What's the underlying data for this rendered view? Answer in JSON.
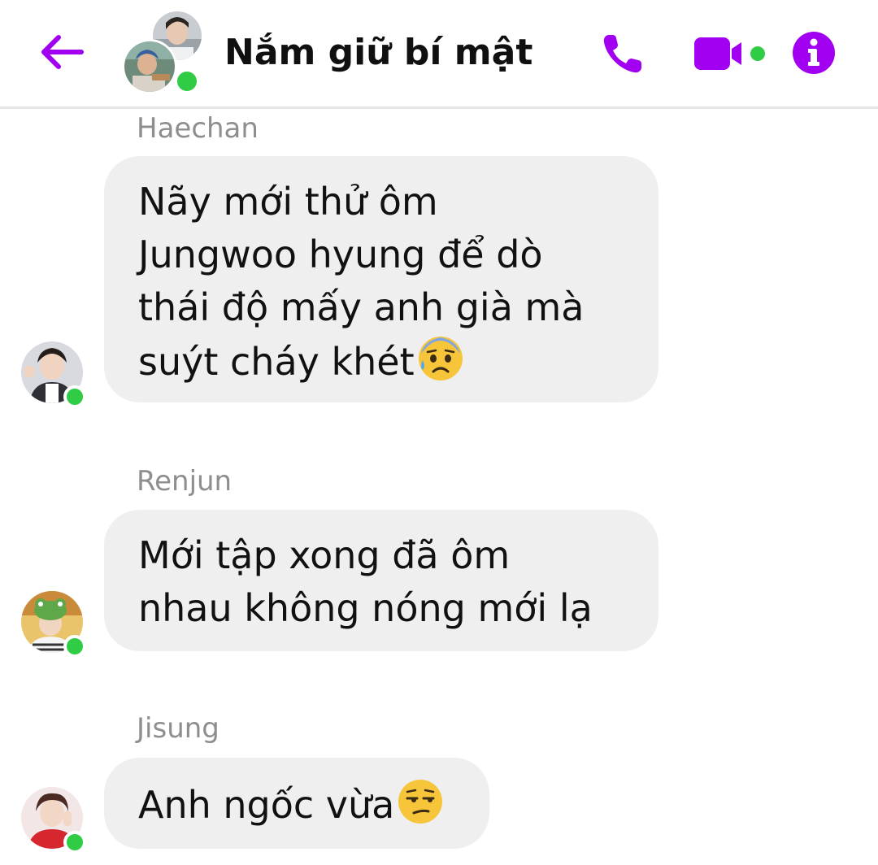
{
  "header": {
    "title": "Nắm giữ bí mật",
    "back_icon": "arrow-left-icon",
    "call_icon": "phone-icon",
    "video_icon": "video-camera-icon",
    "info_icon": "info-icon",
    "accent_color": "#a200f0",
    "online_color": "#31cc46"
  },
  "messages": [
    {
      "sender": "Haechan",
      "text": "Nãy mới thử ôm\nJungwoo hyung để dò\nthái độ mấy anh già mà\nsuýt cháy khét",
      "emoji": "anxious-sweat-face-emoji"
    },
    {
      "sender": "Renjun",
      "text": "Mới tập xong đã ôm\nnhau không nóng mới lạ",
      "emoji": ""
    },
    {
      "sender": "Jisung",
      "text": "Anh ngốc vừa",
      "emoji": "unamused-face-emoji"
    }
  ]
}
